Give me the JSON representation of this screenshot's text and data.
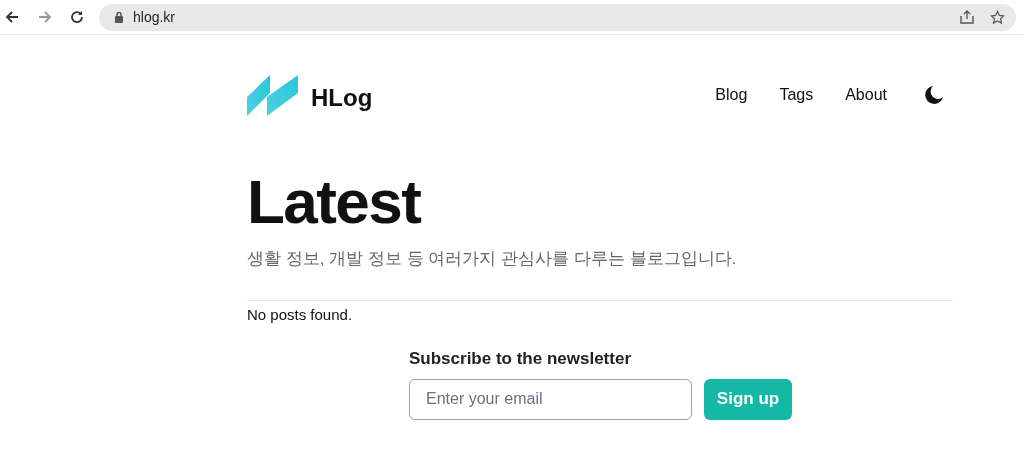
{
  "browser": {
    "url": "hlog.kr"
  },
  "header": {
    "site_name": "HLog",
    "nav": [
      {
        "label": "Blog"
      },
      {
        "label": "Tags"
      },
      {
        "label": "About"
      }
    ]
  },
  "hero": {
    "title": "Latest",
    "description": "생활 정보, 개발 정보 등 여러가지 관심사를 다루는 블로그입니다."
  },
  "posts": {
    "empty_message": "No posts found."
  },
  "newsletter": {
    "heading": "Subscribe to the newsletter",
    "placeholder": "Enter your email",
    "button": "Sign up"
  }
}
